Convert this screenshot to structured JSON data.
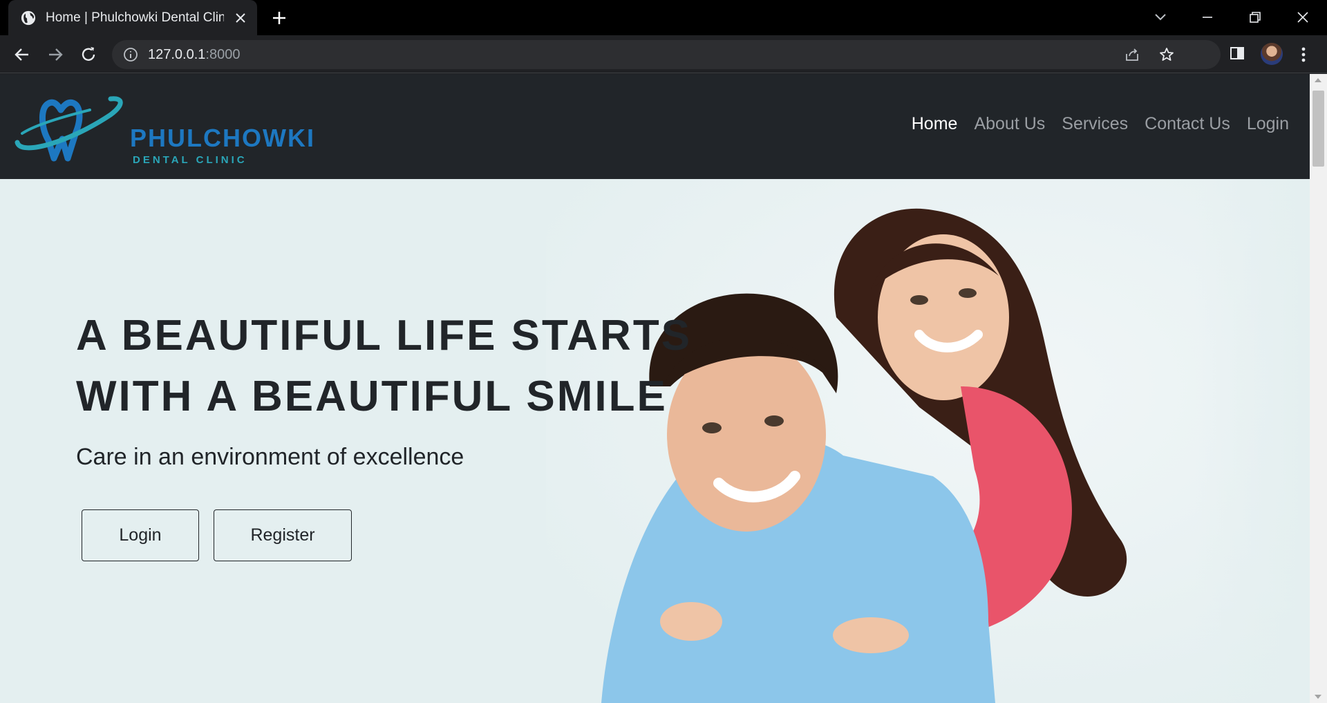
{
  "browser": {
    "tab_title": "Home | Phulchowki Dental Clinic",
    "url_host": "127.0.0.1",
    "url_port": ":8000"
  },
  "site": {
    "logo": {
      "name": "PHULCHOWKI",
      "subtitle": "DENTAL CLINIC"
    },
    "nav": [
      {
        "label": "Home",
        "active": true
      },
      {
        "label": "About Us",
        "active": false
      },
      {
        "label": "Services",
        "active": false
      },
      {
        "label": "Contact Us",
        "active": false
      },
      {
        "label": "Login",
        "active": false
      }
    ],
    "hero": {
      "title_line1": "A BEAUTIFUL LIFE STARTS",
      "title_line2": "WITH A BEAUTIFUL SMILE",
      "subtitle": "Care in an environment of excellence",
      "login_label": "Login",
      "register_label": "Register"
    }
  },
  "colors": {
    "nav_bg": "#212529",
    "hero_bg": "#e4eff0",
    "logo_blue": "#1d78c1",
    "logo_teal": "#2aa6b8",
    "chrome_bg": "#202124"
  },
  "icons": [
    "globe-icon",
    "close-icon",
    "plus-icon",
    "back-icon",
    "forward-icon",
    "reload-icon",
    "info-icon",
    "share-icon",
    "star-icon",
    "side-panel-icon",
    "more-vert-icon"
  ]
}
